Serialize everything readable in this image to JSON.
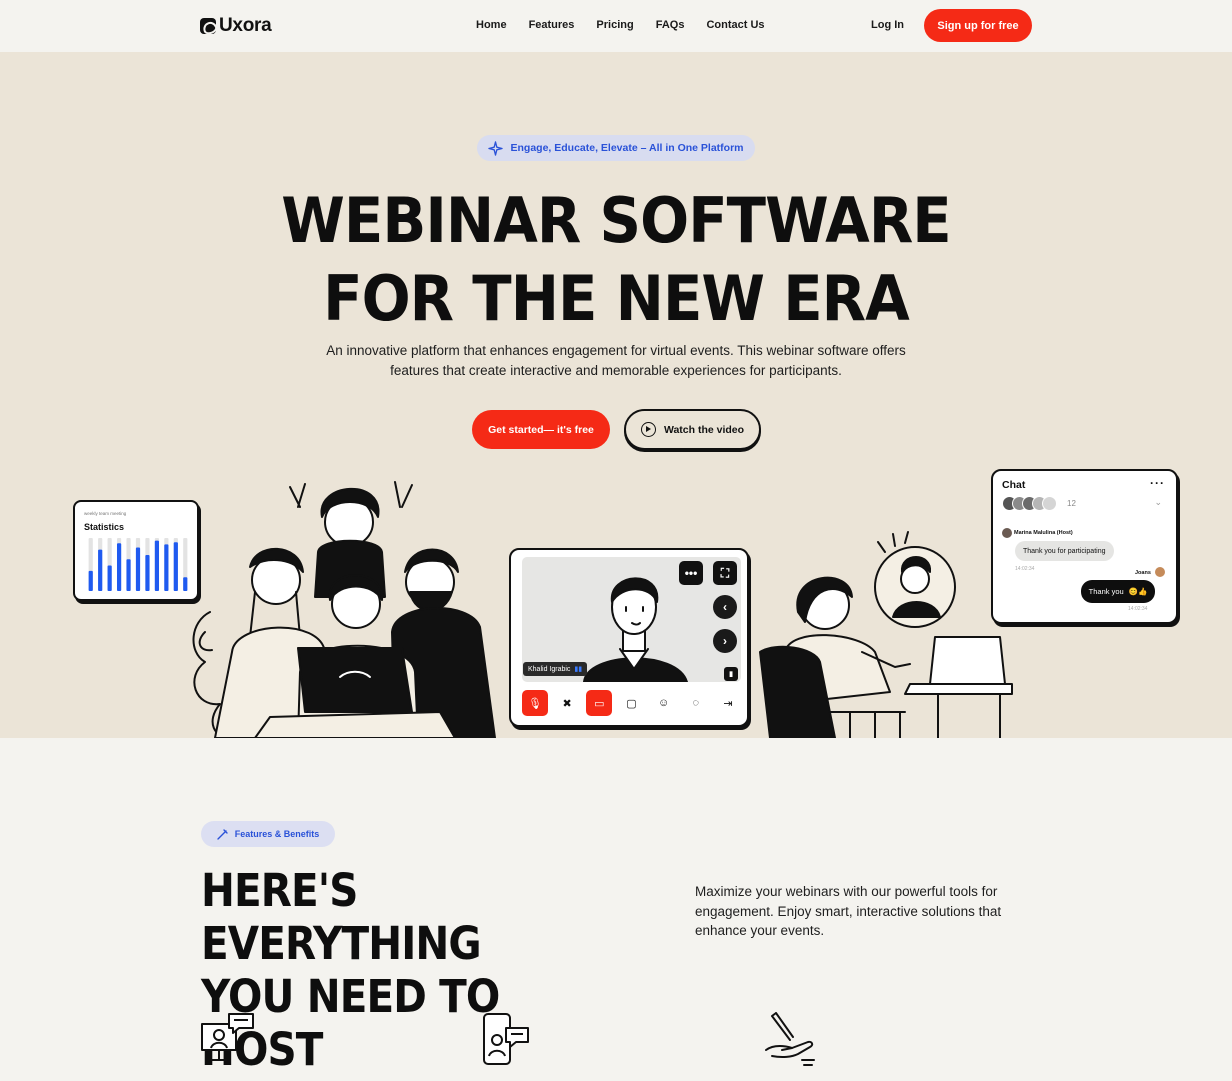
{
  "nav": {
    "brand": "Uxora",
    "links": [
      "Home",
      "Features",
      "Pricing",
      "FAQs",
      "Contact Us"
    ],
    "login": "Log In",
    "signup": "Sign up for free"
  },
  "hero": {
    "badge": "Engage, Educate, Elevate – All in One Platform",
    "title_line1": "WEBINAR SOFTWARE",
    "title_line2": "FOR THE NEW ERA",
    "subtitle": "An innovative platform that enhances engagement for virtual events. This webinar software offers features that create interactive and memorable experiences for participants.",
    "cta_primary": "Get started— it's free",
    "cta_secondary": "Watch the video"
  },
  "stats_card": {
    "caption": "weekly team meeting",
    "title": "Statistics",
    "bar_levels": [
      0.38,
      0.78,
      0.48,
      0.9,
      0.6,
      0.82,
      0.68,
      0.95,
      0.88,
      0.92,
      0.26
    ]
  },
  "video_card": {
    "participant": "Khalid Igrabic"
  },
  "chat_card": {
    "title": "Chat",
    "participant_count": "12",
    "host_name": "Marina Malulina (Host)",
    "message_in": "Thank you for participating",
    "time_in": "14:02:34",
    "reply_author": "Joans",
    "message_out": "Thank you",
    "message_out_emoji": "😊👍",
    "time_out": "14:02:34"
  },
  "features": {
    "badge": "Features & Benefits",
    "title_line1": "HERE'S EVERYTHING",
    "title_line2": "YOU NEED TO HOST",
    "description": "Maximize your webinars with our powerful tools for engagement. Enjoy smart, interactive solutions that enhance your events."
  },
  "colors": {
    "accent": "#f52a16",
    "hero_bg": "#ebe4d7",
    "page_bg": "#f4f3ef",
    "badge_blue": "#2a52d8",
    "chart_blue": "#1f5af0"
  }
}
